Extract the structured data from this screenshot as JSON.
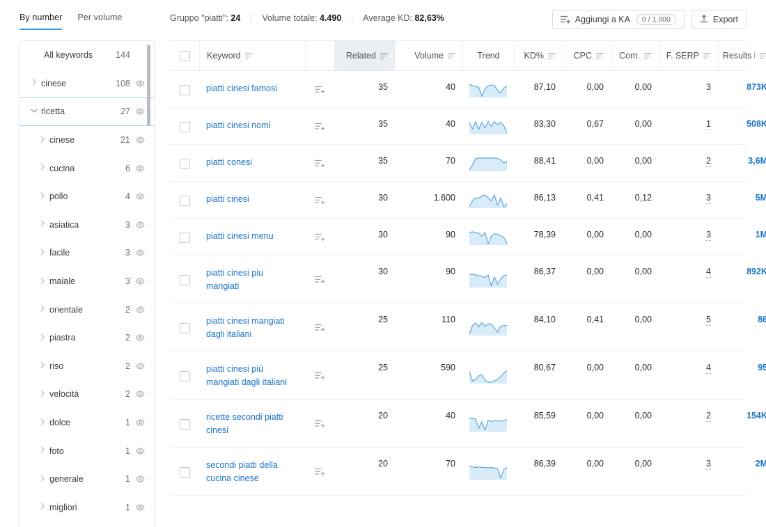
{
  "view_tabs": [
    {
      "label": "By number",
      "active": true
    },
    {
      "label": "Per volume",
      "active": false
    }
  ],
  "summary": [
    {
      "label": "Gruppo \"piatti\":",
      "value": "24"
    },
    {
      "label": "Volume totale:",
      "value": "4.490"
    },
    {
      "label": "Average KD:",
      "value": "82,63%"
    }
  ],
  "actions": {
    "add_to_ka": "Aggiungi a KA",
    "add_to_ka_counter": "0 / 1.000",
    "export": "Export"
  },
  "sidebar": {
    "items": [
      {
        "label": "All keywords",
        "count": "144",
        "level": 0,
        "caret": false,
        "eye": false,
        "selected": false
      },
      {
        "label": "cinese",
        "count": "108",
        "level": 1,
        "caret": "right",
        "eye": true,
        "selected": false
      },
      {
        "label": "ricetta",
        "count": "27",
        "level": 1,
        "caret": "down",
        "eye": true,
        "selected": true
      },
      {
        "label": "cinese",
        "count": "21",
        "level": 2,
        "caret": "right",
        "eye": true,
        "selected": false
      },
      {
        "label": "cucina",
        "count": "6",
        "level": 2,
        "caret": "right",
        "eye": true,
        "selected": false
      },
      {
        "label": "pollo",
        "count": "4",
        "level": 2,
        "caret": "right",
        "eye": true,
        "selected": false
      },
      {
        "label": "asiatica",
        "count": "3",
        "level": 2,
        "caret": "right",
        "eye": true,
        "selected": false
      },
      {
        "label": "facile",
        "count": "3",
        "level": 2,
        "caret": "right",
        "eye": true,
        "selected": false
      },
      {
        "label": "maiale",
        "count": "3",
        "level": 2,
        "caret": "right",
        "eye": true,
        "selected": false
      },
      {
        "label": "orientale",
        "count": "2",
        "level": 2,
        "caret": "right",
        "eye": true,
        "selected": false
      },
      {
        "label": "piastra",
        "count": "2",
        "level": 2,
        "caret": "right",
        "eye": true,
        "selected": false
      },
      {
        "label": "riso",
        "count": "2",
        "level": 2,
        "caret": "right",
        "eye": true,
        "selected": false
      },
      {
        "label": "velocità",
        "count": "2",
        "level": 2,
        "caret": "right",
        "eye": true,
        "selected": false
      },
      {
        "label": "dolce",
        "count": "1",
        "level": 2,
        "caret": "right",
        "eye": true,
        "selected": false
      },
      {
        "label": "foto",
        "count": "1",
        "level": 2,
        "caret": "right",
        "eye": true,
        "selected": false
      },
      {
        "label": "generale",
        "count": "1",
        "level": 2,
        "caret": "right",
        "eye": true,
        "selected": false
      },
      {
        "label": "migliori",
        "count": "1",
        "level": 2,
        "caret": "right",
        "eye": true,
        "selected": false
      }
    ]
  },
  "table": {
    "columns": [
      {
        "key": "checkbox",
        "label": "",
        "sortable": false,
        "sorted": false
      },
      {
        "key": "keyword",
        "label": "Keyword",
        "sortable": true,
        "sorted": false
      },
      {
        "key": "add",
        "label": "",
        "sortable": false,
        "sorted": false
      },
      {
        "key": "related",
        "label": "Related",
        "sortable": true,
        "sorted": true
      },
      {
        "key": "volume",
        "label": "Volume",
        "sortable": true,
        "sorted": false
      },
      {
        "key": "trend",
        "label": "Trend",
        "sortable": false,
        "sorted": false
      },
      {
        "key": "kd",
        "label": "KD%",
        "sortable": true,
        "sorted": false
      },
      {
        "key": "cpc",
        "label": "CPC",
        "sortable": true,
        "sorted": false
      },
      {
        "key": "com",
        "label": "Com.",
        "sortable": true,
        "sorted": false
      },
      {
        "key": "fserp",
        "label": "F. SERP",
        "sortable": true,
        "sorted": false
      },
      {
        "key": "results",
        "label": "Results",
        "sortable": true,
        "sorted": false,
        "info": true
      }
    ],
    "rows": [
      {
        "keyword": "piatti cinesi famosi",
        "related": "35",
        "volume": "40",
        "kd": "87,10",
        "cpc": "0,00",
        "com": "0,00",
        "fserp": "3",
        "results": "873K",
        "trend": [
          30,
          28,
          27,
          26,
          14,
          24,
          28,
          29,
          28,
          22,
          18,
          25,
          27
        ]
      },
      {
        "keyword": "piatti cinesi nomi",
        "related": "35",
        "volume": "40",
        "kd": "83,30",
        "cpc": "0,67",
        "com": "0,00",
        "fserp": "1",
        "results": "508K",
        "trend": [
          26,
          14,
          28,
          13,
          27,
          16,
          29,
          19,
          28,
          22,
          27,
          20,
          6
        ]
      },
      {
        "keyword": "piatti conesi",
        "related": "35",
        "volume": "70",
        "kd": "88,41",
        "cpc": "0,00",
        "com": "0,00",
        "fserp": "2",
        "results": "3,6M",
        "trend": [
          6,
          16,
          29,
          30,
          30,
          30,
          30,
          30,
          30,
          29,
          26,
          20,
          24
        ]
      },
      {
        "keyword": "piatti cinesi",
        "related": "30",
        "volume": "1.600",
        "kd": "86,13",
        "cpc": "0,41",
        "com": "0,12",
        "fserp": "3",
        "results": "5M",
        "trend": [
          12,
          16,
          18,
          18,
          19,
          20,
          18,
          16,
          20,
          13,
          18,
          12,
          14
        ]
      },
      {
        "keyword": "piatti cinesi menu",
        "related": "30",
        "volume": "90",
        "kd": "78,39",
        "cpc": "0,00",
        "com": "0,00",
        "fserp": "3",
        "results": "1M",
        "trend": [
          26,
          27,
          26,
          25,
          20,
          26,
          8,
          20,
          24,
          23,
          21,
          18,
          8
        ]
      },
      {
        "keyword": "piatti cinesi piu mangiati",
        "related": "30",
        "volume": "90",
        "kd": "86,37",
        "cpc": "0,00",
        "com": "0,00",
        "fserp": "4",
        "results": "892K",
        "trend": [
          27,
          27,
          26,
          25,
          24,
          22,
          26,
          9,
          23,
          12,
          20,
          25,
          26
        ]
      },
      {
        "keyword": "piatti cinesi mangiati dagli italiani",
        "related": "25",
        "volume": "110",
        "kd": "84,10",
        "cpc": "0,41",
        "com": "0,00",
        "fserp": "5",
        "results": "86",
        "trend": [
          9,
          22,
          26,
          20,
          27,
          21,
          25,
          24,
          19,
          12,
          21,
          22,
          22
        ]
      },
      {
        "keyword": "piatti cinesi più mangiati dagli italiani",
        "related": "25",
        "volume": "590",
        "kd": "80,67",
        "cpc": "0,00",
        "com": "0,00",
        "fserp": "4",
        "results": "95",
        "trend": [
          24,
          11,
          13,
          18,
          20,
          12,
          9,
          9,
          11,
          13,
          17,
          22,
          26
        ]
      },
      {
        "keyword": "ricette secondi piatti cinesi",
        "related": "20",
        "volume": "40",
        "kd": "85,59",
        "cpc": "0,00",
        "com": "0,00",
        "fserp": "2",
        "results": "154K",
        "trend": [
          27,
          27,
          26,
          12,
          22,
          9,
          24,
          22,
          24,
          23,
          23,
          24,
          25
        ]
      },
      {
        "keyword": "secondi piatti della cucina cinese",
        "related": "20",
        "volume": "70",
        "kd": "86,39",
        "cpc": "0,00",
        "com": "0,00",
        "fserp": "3",
        "results": "2M",
        "trend": [
          28,
          27,
          26,
          27,
          26,
          26,
          25,
          26,
          25,
          24,
          5,
          22,
          26
        ]
      }
    ]
  },
  "colors": {
    "link": "#1a73c7",
    "accent": "#3b9ee2",
    "spark": "#5ca8e0",
    "spark_fill": "#d8ebf8"
  }
}
